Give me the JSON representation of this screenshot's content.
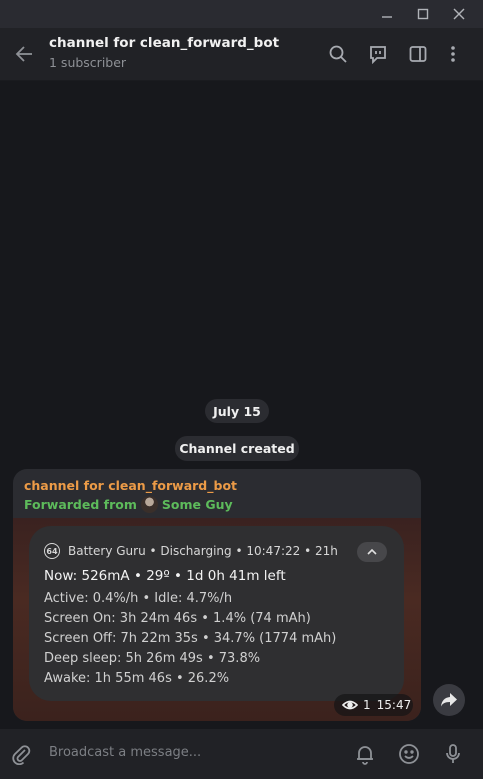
{
  "header": {
    "title": "channel for clean_forward_bot",
    "subtitle": "1 subscriber"
  },
  "chat": {
    "date": "July 15",
    "service_message": "Channel created"
  },
  "message": {
    "channel_name": "channel for clean_forward_bot",
    "forwarded_prefix": "Forwarded from",
    "forwarded_from": "Some Guy",
    "views": "1",
    "time": "15:47",
    "notification": {
      "app_icon_text": "64",
      "header": "Battery Guru • Discharging • 10:47:22 • 21h",
      "main_line": "Now: 526mA • 29º • 1d 0h 41m left",
      "lines": [
        "Active: 0.4%/h • Idle: 4.7%/h",
        "Screen On: 3h 24m 46s • 1.4% (74 mAh)",
        "Screen Off: 7h 22m 35s • 34.7% (1774 mAh)",
        "Deep sleep: 5h 26m 49s • 73.8%",
        "Awake: 1h 55m 46s • 26.2%"
      ]
    }
  },
  "composer": {
    "placeholder": "Broadcast a message..."
  },
  "colors": {
    "channel_name": "#ec9b47",
    "forwarded": "#5dbb5b",
    "background": "#17181c"
  },
  "icons": [
    "minimize-icon",
    "maximize-icon",
    "close-icon",
    "back-arrow-icon",
    "search-icon",
    "live-stream-icon",
    "sidebar-toggle-icon",
    "more-vert-icon",
    "eye-icon",
    "share-icon",
    "attach-icon",
    "bell-icon",
    "emoji-icon",
    "microphone-icon"
  ]
}
